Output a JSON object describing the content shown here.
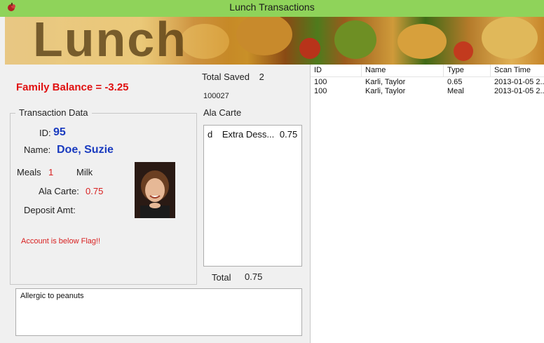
{
  "window": {
    "title": "Lunch Transactions"
  },
  "banner": {
    "logo_text": "Lunch"
  },
  "family_balance": "Family Balance = -3.25",
  "total_saved": {
    "label": "Total Saved",
    "value": "2"
  },
  "transaction_number": "100027",
  "ala_carte_header": "Ala Carte",
  "transaction_data": {
    "group_label": "Transaction Data",
    "id_label": "ID:",
    "id_value": "95",
    "name_label": "Name:",
    "name_value": "Doe, Suzie",
    "meals_label": "Meals",
    "meals_value": "1",
    "milk_label": "Milk",
    "ala_carte_label": "Ala Carte:",
    "ala_carte_value": "0.75",
    "deposit_label": "Deposit Amt:",
    "warning": "Account is below Flag!!"
  },
  "ala_carte_items": [
    {
      "code": "d",
      "name": "Extra Dess...",
      "price": "0.75"
    }
  ],
  "total": {
    "label": "Total",
    "value": "0.75"
  },
  "notes": "Allergic to peanuts",
  "grid": {
    "columns": [
      "ID",
      "Name",
      "Type",
      "Scan Time"
    ],
    "rows": [
      [
        "100",
        "Karli, Taylor",
        "0.65",
        "2013-01-05 2..."
      ],
      [
        "100",
        "Karli, Taylor",
        "Meal",
        "2013-01-05 2..."
      ]
    ]
  },
  "colors": {
    "titlebar": "#8fd35a",
    "balance_red": "#e01010",
    "name_blue": "#1a3bbf"
  }
}
